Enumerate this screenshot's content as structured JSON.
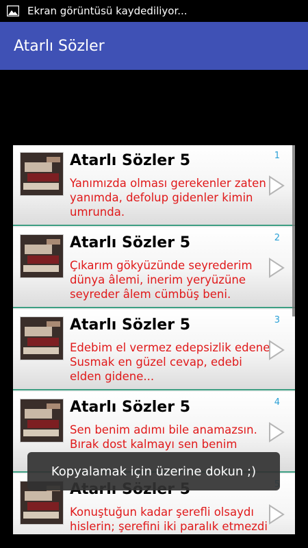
{
  "status_bar": {
    "icon": "image-icon",
    "text": "Ekran görüntüsü kaydediliyor..."
  },
  "app_bar": {
    "title": "Atarlı Sözler"
  },
  "list": {
    "items": [
      {
        "number": "1",
        "title": "Atarlı Sözler 5",
        "text": "Yanımızda olması gerekenler zaten yanımda, defolup gidenler kimin umrunda."
      },
      {
        "number": "2",
        "title": "Atarlı Sözler 5",
        "text": "Çıkarım gökyüzünde seyrederim dünya âlemi, inerim yeryüzüne seyreder âlem cümbüş beni."
      },
      {
        "number": "3",
        "title": "Atarlı Sözler 5",
        "text": "Edebim el vermez edepsizlik edene. Susmak en güzel cevap, edebi elden gidene..."
      },
      {
        "number": "4",
        "title": "Atarlı Sözler 5",
        "text": "Sen benim adımı bile anamazsın. Bırak dost kalmayı sen benim"
      },
      {
        "number": "5",
        "title": "Atarlı Sözler 5",
        "text": "Konuştuğun kadar şerefli olsaydı hislerin; şerefini iki paralık etmezdi"
      }
    ]
  },
  "toast": {
    "text": "Kopyalamak için üzerine dokun ;)"
  },
  "colors": {
    "app_bar": "#3f51b5",
    "item_text": "#e0191a",
    "item_number": "#2aa0d6",
    "divider": "#3c9e82"
  }
}
